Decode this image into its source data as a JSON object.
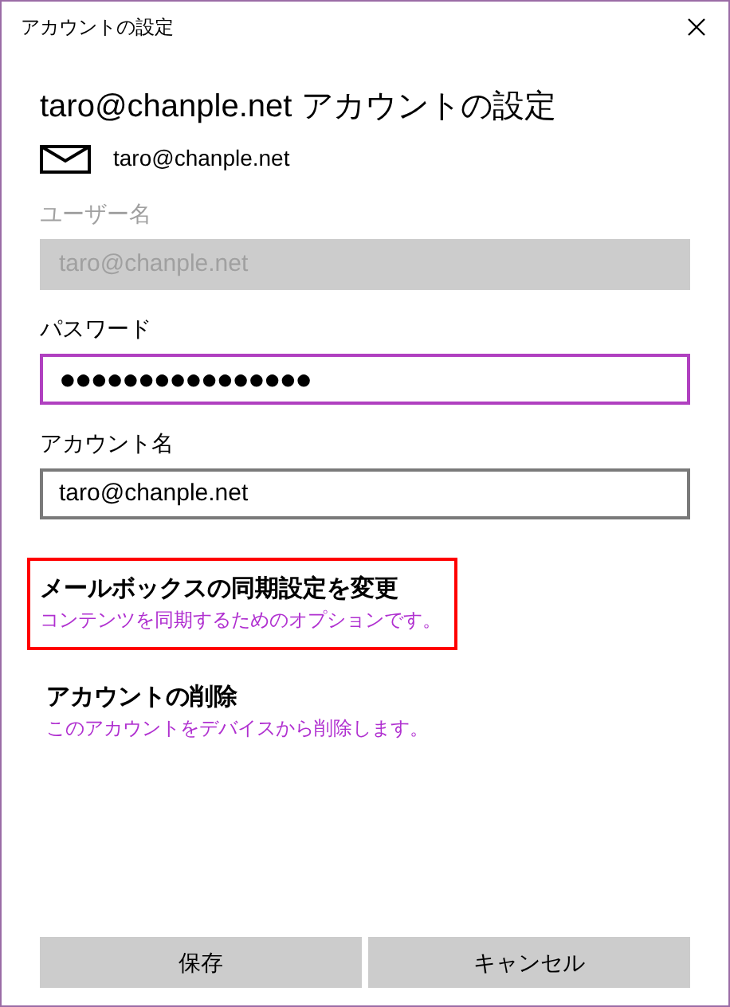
{
  "window": {
    "title": "アカウントの設定"
  },
  "heading": {
    "account": "taro@chanple.net",
    "title": "アカウントの設定"
  },
  "account_row": {
    "email": "taro@chanple.net"
  },
  "fields": [
    {
      "label": "ユーザー名",
      "value": "taro@chanple.net",
      "disabled": true,
      "focused": false
    },
    {
      "label": "パスワード",
      "value": "●●●●●●●●●●●●●●●●",
      "disabled": false,
      "focused": true
    },
    {
      "label": "アカウント名",
      "value": "taro@chanple.net",
      "disabled": false,
      "focused": false
    }
  ],
  "options": [
    {
      "title": "メールボックスの同期設定を変更",
      "description": "コンテンツを同期するためのオプションです。",
      "highlighted": true
    },
    {
      "title": "アカウントの削除",
      "description": "このアカウントをデバイスから削除します。",
      "highlighted": false
    }
  ],
  "buttons": [
    "保存",
    "キャンセル"
  ]
}
